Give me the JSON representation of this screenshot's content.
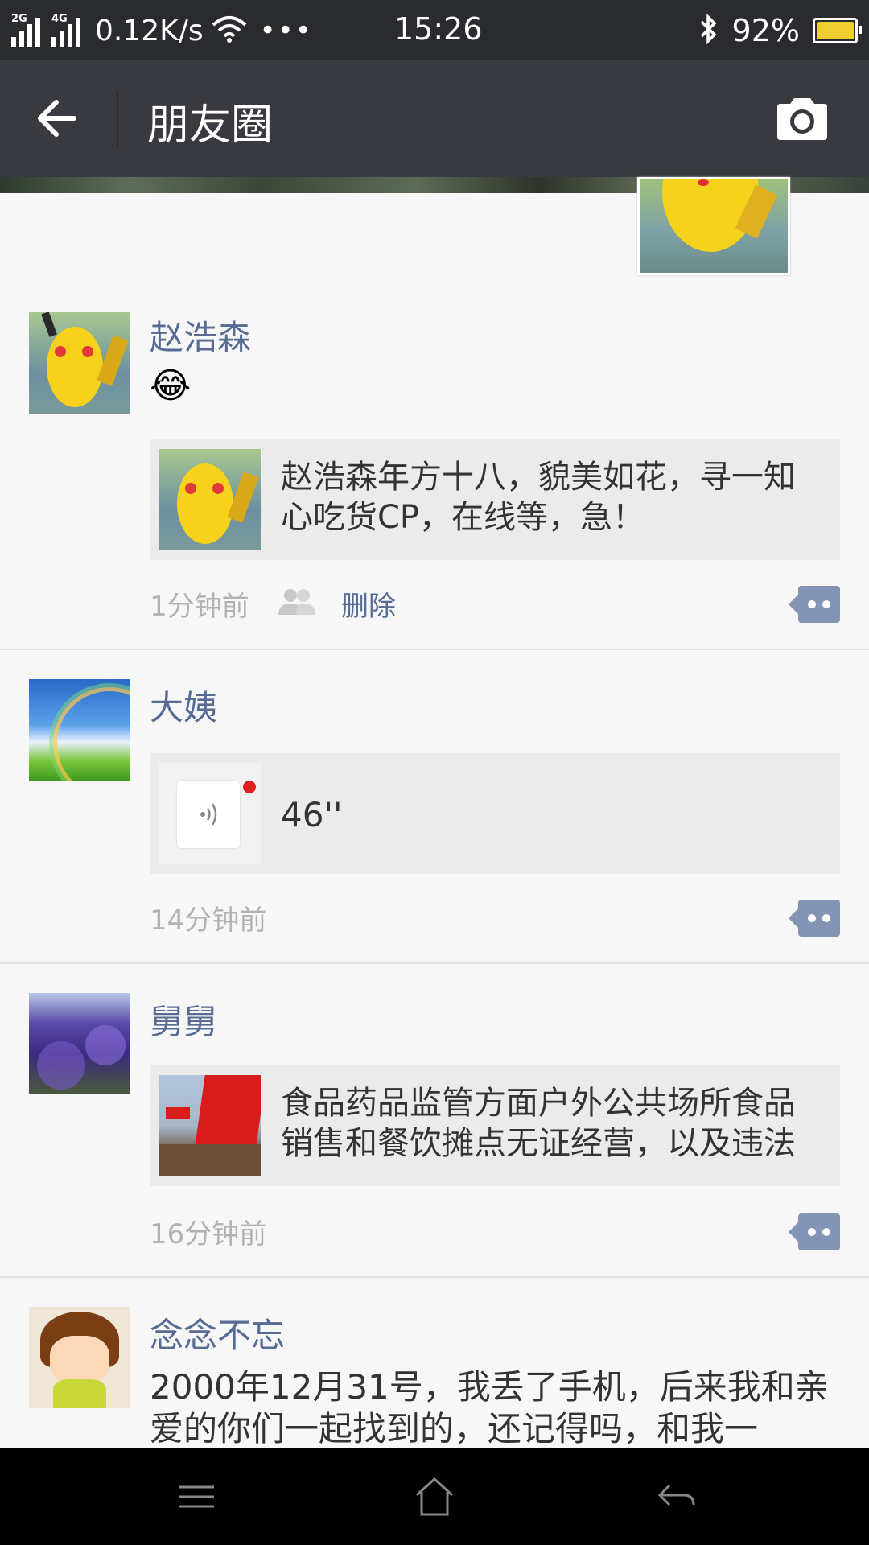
{
  "status_bar": {
    "network_2g": "2G",
    "network_4g": "4G",
    "speed": "0.12K/s",
    "time": "15:26",
    "battery_pct": "92%",
    "battery_level": 0.92
  },
  "header": {
    "title": "朋友圈",
    "back_icon": "arrow-left-icon",
    "camera_icon": "camera-icon"
  },
  "posts": [
    {
      "name": "赵浩森",
      "emoji": "😂",
      "share_text": "赵浩森年方十八，貌美如花，寻一知心吃货CP，在线等，急！",
      "time": "1分钟前",
      "delete_label": "删除"
    },
    {
      "name": "大姨",
      "voice_duration": "46''",
      "time": "14分钟前"
    },
    {
      "name": "舅舅",
      "share_text": "食品药品监管方面户外公共场所食品销售和餐饮摊点无证经营，以及违法",
      "time": "16分钟前"
    },
    {
      "name": "念念不忘",
      "text": "2000年12月31号，我丢了手机，后来我和亲爱的你们一起找到的，还记得吗，和我一"
    }
  ],
  "colors": {
    "nickname": "#576b95",
    "titlebar": "#393a3f",
    "statusbar": "#2a2b2f",
    "comment_button": "#8494b5"
  }
}
